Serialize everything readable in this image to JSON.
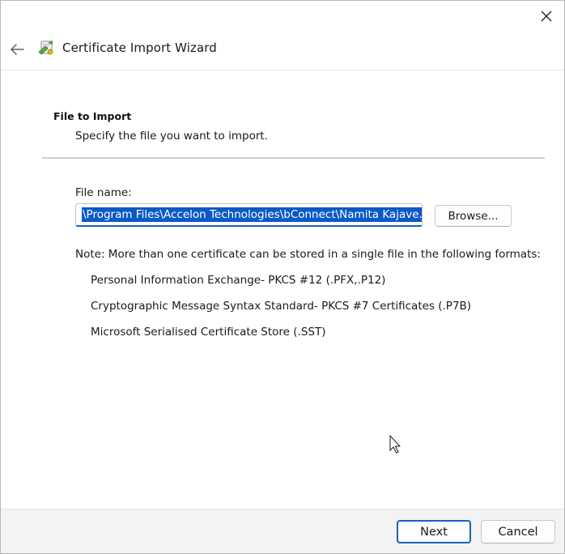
{
  "window": {
    "title": "Certificate Import Wizard",
    "close_icon": "close-icon",
    "back_icon": "back-arrow-icon",
    "app_icon": "certificate-icon"
  },
  "page": {
    "heading": "File to Import",
    "subheading": "Specify the file you want to import."
  },
  "file_field": {
    "label": "File name:",
    "value": "\\Program Files\\Accelon Technologies\\bConnect\\Namita Kajave.pfx",
    "browse_label": "Browse..."
  },
  "note": {
    "text": "Note:  More than one certificate can be stored in a single file in the following formats:",
    "formats": [
      "Personal Information Exchange- PKCS #12 (.PFX,.P12)",
      "Cryptographic Message Syntax Standard- PKCS #7 Certificates (.P7B)",
      "Microsoft Serialised Certificate Store (.SST)"
    ]
  },
  "footer": {
    "next_label": "Next",
    "cancel_label": "Cancel"
  },
  "colors": {
    "accent": "#1a62b8",
    "selection": "#0a59c7",
    "footer_bg": "#f3f3f3"
  }
}
